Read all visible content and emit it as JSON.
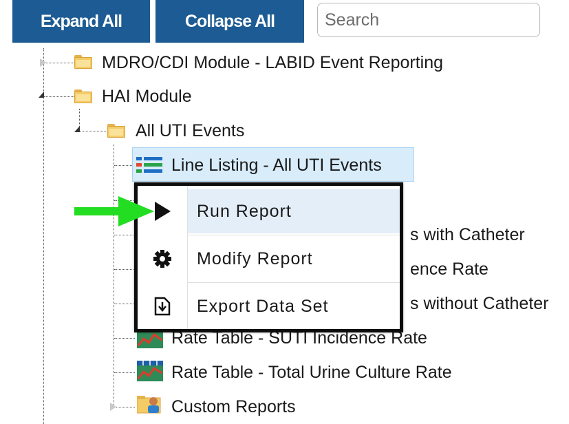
{
  "toolbar": {
    "expand_all": "Expand All",
    "collapse_all": "Collapse All",
    "search_placeholder": "Search"
  },
  "tree": {
    "mdro": "MDRO/CDI Module - LABID Event Reporting",
    "hai": "HAI Module",
    "uti": "All UTI Events",
    "line_listing": "Line Listing - All UTI Events",
    "partial_1": "s with Catheter",
    "partial_2": "ence Rate",
    "partial_3": "s without Catheter",
    "rate_suti": "Rate Table - SUTI Incidence Rate",
    "rate_urine": "Rate Table - Total Urine Culture Rate",
    "custom": "Custom Reports"
  },
  "context_menu": {
    "items": [
      {
        "label": "Run Report",
        "icon": "play-icon",
        "hovered": true
      },
      {
        "label": "Modify Report",
        "icon": "gear-icon"
      },
      {
        "label": "Export Data Set",
        "icon": "export-icon"
      }
    ]
  },
  "colors": {
    "button_bg": "#1c5b93",
    "selection_bg": "#d8ecfa",
    "arrow_green": "#22dd22"
  }
}
